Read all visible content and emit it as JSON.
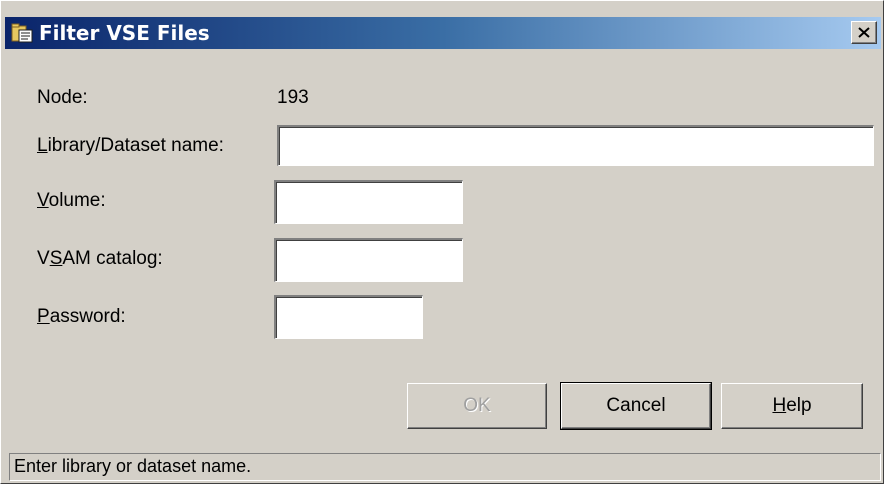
{
  "window": {
    "title": "Filter VSE Files",
    "close_label": "×"
  },
  "form": {
    "node_label": "Node:",
    "node_value": "193",
    "library_label_accel": "L",
    "library_label_rest": "ibrary/Dataset name:",
    "library_value": "",
    "volume_label_accel": "V",
    "volume_label_rest": "olume:",
    "volume_value": "",
    "vsam_label_pre": "V",
    "vsam_label_accel": "S",
    "vsam_label_rest": "AM catalog:",
    "vsam_value": "",
    "password_label_accel": "P",
    "password_label_rest": "assword:",
    "password_value": ""
  },
  "buttons": {
    "ok_label": "OK",
    "ok_enabled": false,
    "cancel_label": "Cancel",
    "help_accel": "H",
    "help_rest": "elp"
  },
  "status": {
    "text": "Enter library or dataset name."
  },
  "colors": {
    "titlebar_start": "#0a246a",
    "titlebar_end": "#a6caf0",
    "dialog_bg": "#d4d0c8",
    "disabled_text": "#a0a0a0"
  },
  "icons": {
    "title_icon": "folder-files-icon",
    "close_icon": "close-x-icon"
  }
}
